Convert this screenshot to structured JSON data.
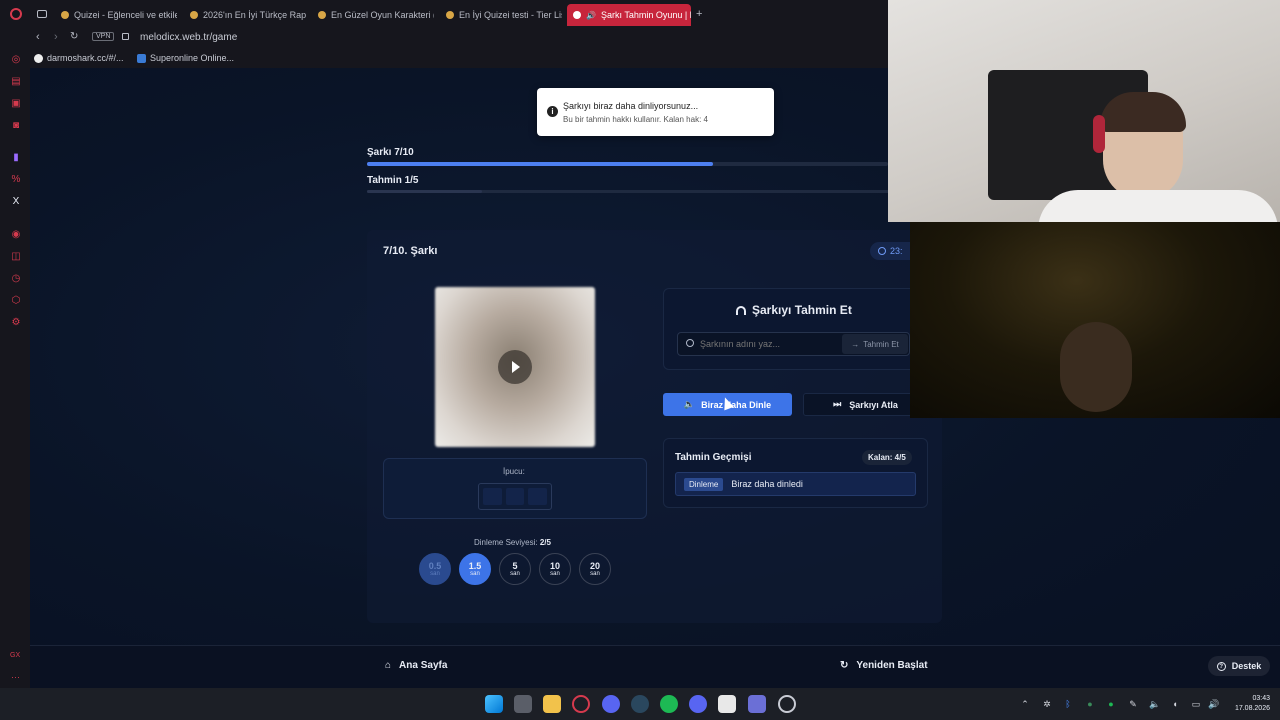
{
  "browser": {
    "tabs": [
      {
        "label": "Quizei - Eğlenceli ve etkiles"
      },
      {
        "label": "2026'ın En İyi Türkçe Rap"
      },
      {
        "label": "En Güzel Oyun Karakteri (2"
      },
      {
        "label": "En İyi Quizei testi - Tier List"
      },
      {
        "label": "Şarkı Tahmin Oyunu | M"
      }
    ],
    "new_tab": "+",
    "vpn_badge": "VPN",
    "url": "melodicx.web.tr/game",
    "bookmarks": [
      {
        "label": "darmoshark.cc/#/..."
      },
      {
        "label": "Superonline Online..."
      }
    ],
    "sidebar_bottom_label": "GX",
    "sidebar_more": "···"
  },
  "toast": {
    "title": "Şarkıyı biraz daha dinliyorsunuz...",
    "message": "Bu bir tahmin hakkı kullanır. Kalan hak: 4"
  },
  "progress": {
    "song_label": "Şarkı 7/10",
    "song_fraction": 0.7,
    "guess_label": "Tahmin 1/5",
    "guess_fraction": 0.2
  },
  "game": {
    "title": "7/10. Şarkı",
    "timer": "23:",
    "hint_label": "İpucu:",
    "listen_level_label": "Dinleme Seviyesi:",
    "listen_level_value": "2/5",
    "levels": [
      {
        "n": "0.5",
        "u": "san"
      },
      {
        "n": "1.5",
        "u": "san"
      },
      {
        "n": "5",
        "u": "san"
      },
      {
        "n": "10",
        "u": "san"
      },
      {
        "n": "20",
        "u": "san"
      }
    ]
  },
  "guess_panel": {
    "title": "Şarkıyı Tahmin Et",
    "input_placeholder": "Şarkının adını yaz...",
    "submit_label": "Tahmin Et",
    "listen_more_label": "Biraz daha Dinle",
    "skip_label": "Şarkıyı Atla"
  },
  "history": {
    "title": "Tahmin Geçmişi",
    "remaining": "Kalan: 4/5",
    "items": [
      {
        "tag": "Dinleme",
        "text": "Biraz daha dinledi"
      }
    ]
  },
  "footer": {
    "home_label": "Ana Sayfa",
    "restart_label": "Yeniden Başlat",
    "support_label": "Destek"
  },
  "clock": {
    "time": "03:43",
    "date": "17.08.2026"
  },
  "colors": {
    "accent": "#3d74e8",
    "browser_accent": "#c7253c"
  }
}
